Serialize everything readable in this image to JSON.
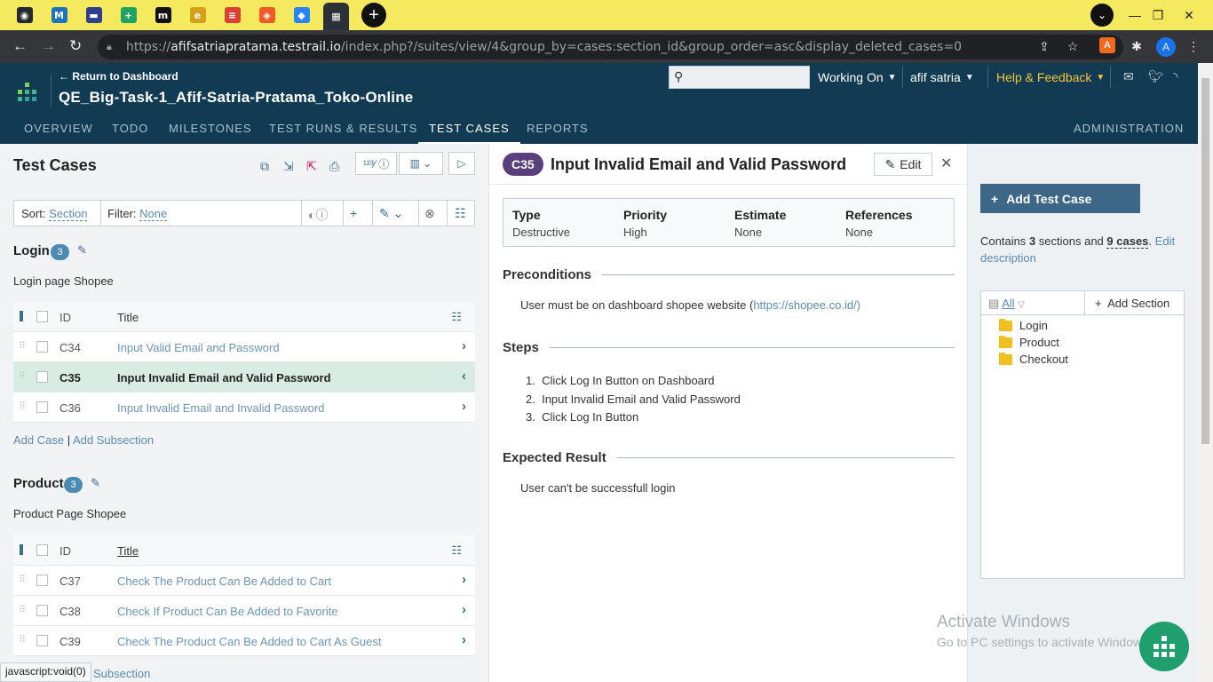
{
  "browser": {
    "url_prefix": "https://",
    "url_host": "afifsatriapratama.testrail.io",
    "url_path": "/index.php?/suites/view/4&group_by=cases:section_id&group_order=asc&display_deleted_cases=0",
    "status_text": "javascript:void(0)",
    "tabs": [
      {
        "icon": "github-icon",
        "glyph": "◉",
        "color": "#24292e"
      },
      {
        "icon": "medium-m-icon",
        "glyph": "M",
        "color": "#1e73be"
      },
      {
        "icon": "dashboard-icon",
        "glyph": "▬",
        "color": "#2c3e8c"
      },
      {
        "icon": "sheets-plus-icon",
        "glyph": "+",
        "color": "#1ea362"
      },
      {
        "icon": "m-logo-icon",
        "glyph": "m",
        "color": "#111"
      },
      {
        "icon": "e-logo-icon",
        "glyph": "e",
        "color": "#d4a017"
      },
      {
        "icon": "todoist-icon",
        "glyph": "≡",
        "color": "#db4035"
      },
      {
        "icon": "postman-icon",
        "glyph": "◈",
        "color": "#ef5b25"
      },
      {
        "icon": "jira-icon",
        "glyph": "◆",
        "color": "#2684ff"
      },
      {
        "icon": "testrail-icon",
        "glyph": "▦",
        "color": "#2b3137"
      }
    ]
  },
  "header": {
    "return_link": "← Return to Dashboard",
    "project_title": "QE_Big-Task-1_Afif-Satria-Pratama_Toko-Online",
    "working_on": "Working On",
    "user": "afif satria",
    "help": "Help & Feedback",
    "nav": [
      "OVERVIEW",
      "TODO",
      "MILESTONES",
      "TEST RUNS & RESULTS",
      "TEST CASES",
      "REPORTS"
    ],
    "admin": "ADMINISTRATION"
  },
  "left": {
    "title": "Test Cases",
    "sort_label": "Sort:",
    "sort_value": "Section",
    "filter_label": "Filter:",
    "filter_value": "None",
    "sections": [
      {
        "name": "Login",
        "count": "3",
        "description": "Login page Shopee",
        "col_id": "ID",
        "col_title": "Title",
        "rows": [
          {
            "id": "C34",
            "title": "Input Valid Email and Password",
            "arrow": "›"
          },
          {
            "id": "C35",
            "title": "Input Invalid Email and Valid Password",
            "arrow": "‹"
          },
          {
            "id": "C36",
            "title": "Input Invalid Email and Invalid Password",
            "arrow": "›"
          }
        ],
        "add_case": "Add Case",
        "sep": "|",
        "add_subsection": "Add Subsection"
      },
      {
        "name": "Product",
        "count": "3",
        "description": "Product Page Shopee",
        "col_id": "ID",
        "col_title": "Title",
        "rows": [
          {
            "id": "C37",
            "title": "Check The Product Can Be Added to Cart",
            "arrow": "›"
          },
          {
            "id": "C38",
            "title": "Check If Product Can Be Added to Favorite",
            "arrow": "›"
          },
          {
            "id": "C39",
            "title": "Check The Product Can Be Added to Cart As Guest",
            "arrow": "›"
          }
        ],
        "add_subsection": "Subsection"
      }
    ]
  },
  "detail": {
    "case_id": "C35",
    "title": "Input Invalid Email and Valid Password",
    "edit": "Edit",
    "fields": [
      {
        "k": "Type",
        "v": "Destructive"
      },
      {
        "k": "Priority",
        "v": "High"
      },
      {
        "k": "Estimate",
        "v": "None"
      },
      {
        "k": "References",
        "v": "None"
      }
    ],
    "preconditions_label": "Preconditions",
    "preconditions_text": "User must be on dashboard shopee website (",
    "preconditions_link": "https://shopee.co.id/)",
    "steps_label": "Steps",
    "steps": [
      "Click Log In Button on Dashboard",
      "Input Invalid Email and Valid Password",
      "Click Log In Button"
    ],
    "expected_label": "Expected Result",
    "expected_text": "User can't be successfull login"
  },
  "right": {
    "add_test_case": "Add Test Case",
    "contains_pre": "Contains",
    "sections_count": "3",
    "contains_mid": "sections and",
    "cases_count": "9 cases",
    "edit_desc": "Edit description",
    "all": "All",
    "add_section": "Add Section",
    "tree": [
      "Login",
      "Product",
      "Checkout"
    ]
  },
  "watermark": {
    "line1": "Activate Windows",
    "line2": "Go to PC settings to activate Windows."
  }
}
